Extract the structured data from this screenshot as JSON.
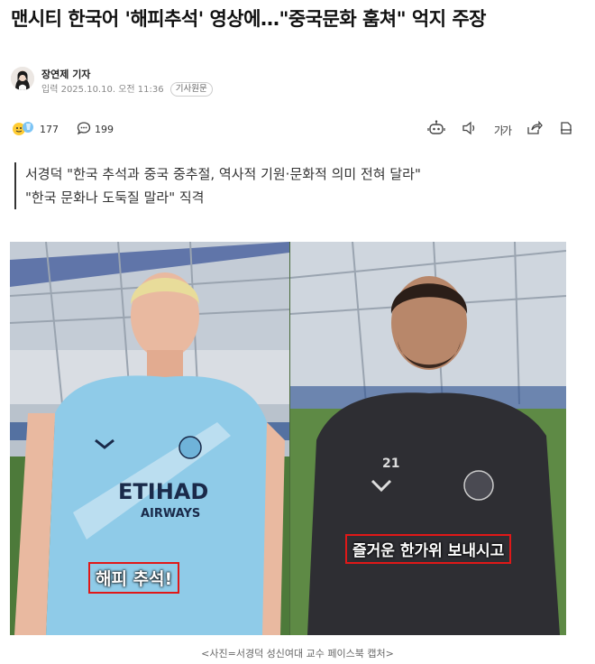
{
  "article": {
    "headline": "맨시티 한국어 '해피추석' 영상에…\"중국문화 훔쳐\" 억지 주장",
    "reporter": "장연제 기자",
    "date_label": "입력 2025.10.10. 오전 11:36",
    "original_button": "기사원문",
    "reactions": "177",
    "comments": "199",
    "font_size_label": "가가",
    "summary": [
      "서경덕 \"한국 추석과 중국 중추절, 역사적 기원·문화적 의미 전혀 달라\"",
      "\"한국 문화나 도둑질 말라\" 직격"
    ],
    "photo": {
      "left_subtitle": "해피 추석!",
      "right_subtitle": "즐거운 한가위 보내시고",
      "left_shirt_text": "ETIHAD",
      "left_shirt_subtext": "AIRWAYS",
      "right_number": "21"
    },
    "caption": "<사진=서경덕 성신여대 교수 페이스북 캡처>"
  },
  "icons": {
    "reaction": "emoji-reaction-icon",
    "comment": "comment-bubble-icon",
    "audio": "robot-audio-icon",
    "speaker": "speaker-icon",
    "share": "share-icon",
    "print": "print-icon"
  },
  "colors": {
    "subtitle_border": "#e01818",
    "city_blue": "#8fcbe8",
    "kit_dark": "#2e2e33"
  }
}
